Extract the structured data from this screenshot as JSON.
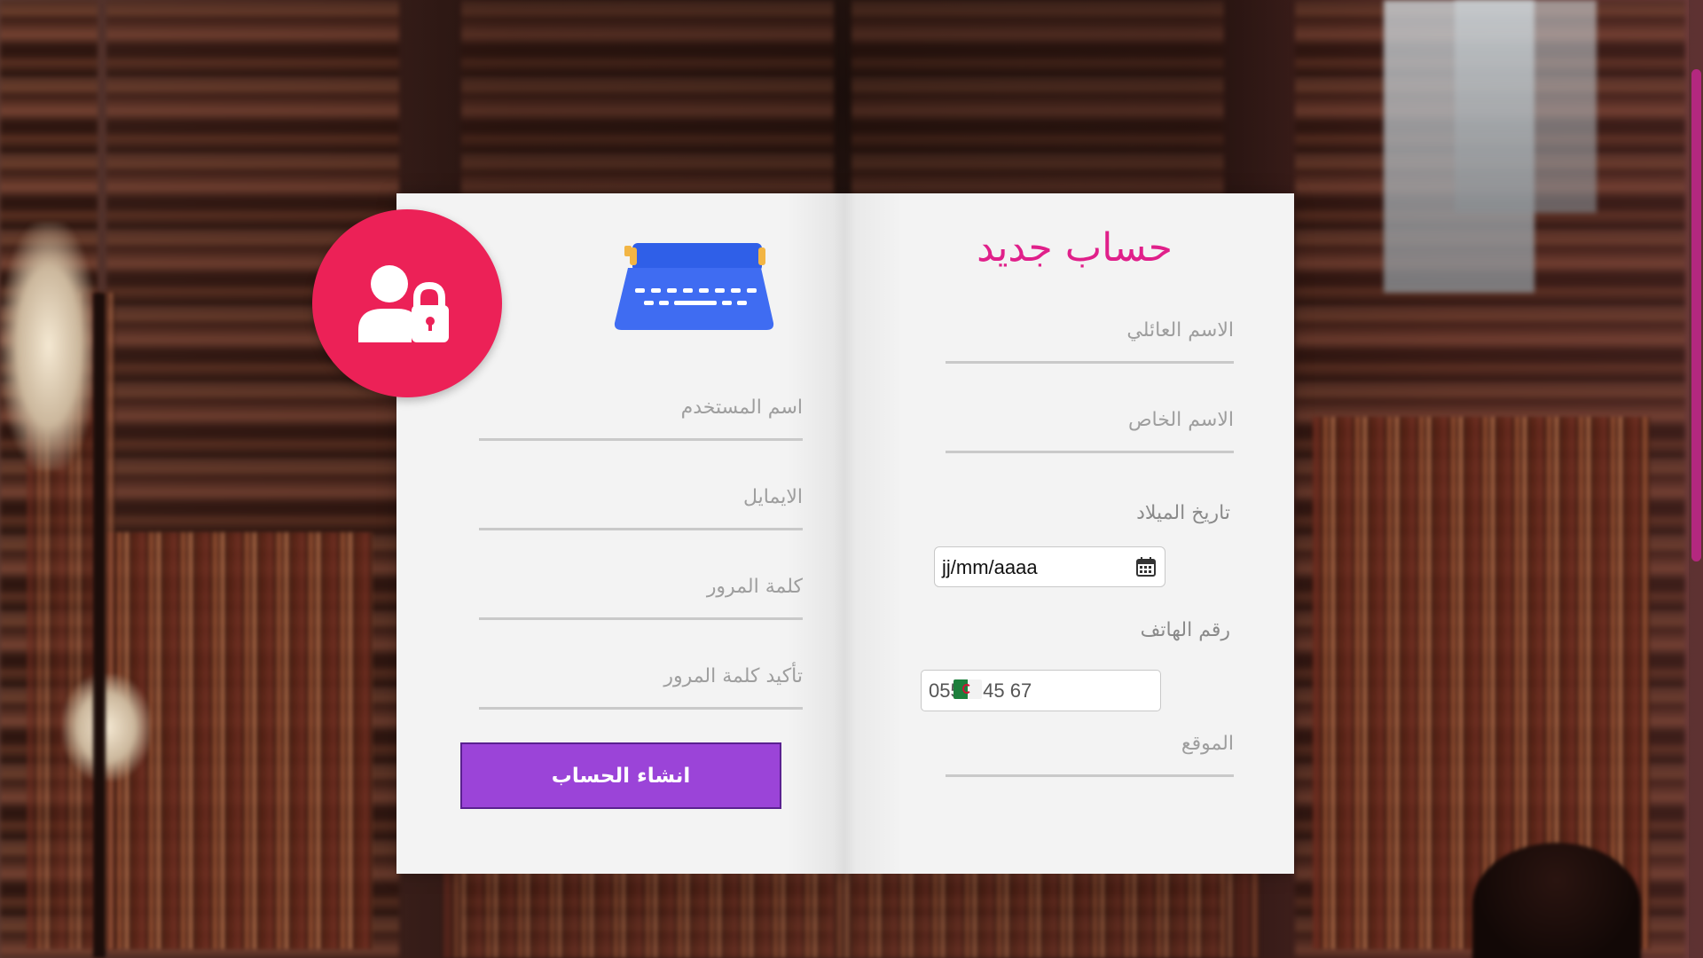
{
  "form": {
    "title": "حساب جديد",
    "fields": {
      "family_name": "الاسم العائلي",
      "first_name": "الاسم الخاص",
      "birth_date_label": "تاريخ الميلاد",
      "birth_date_value": "jj/mm/aaaa",
      "phone_label": "رقم الهاتف",
      "phone_placeholder": "055 3 45 67",
      "location": "الموقع",
      "username": "اسم المستخدم",
      "email": "الايمايل",
      "password": "كلمة المرور",
      "confirm_password": "تأكيد كلمة المرور"
    },
    "submit_label": "انشاء الحساب"
  },
  "icons": {
    "badge": "user-lock-icon",
    "illustration": "typewriter-icon",
    "calendar": "calendar-icon",
    "flag": "algeria-flag-icon"
  },
  "colors": {
    "badge": "#ec2157",
    "title": "#e0208a",
    "button": "#9b44d8",
    "scrollbar": "#b3287f"
  }
}
